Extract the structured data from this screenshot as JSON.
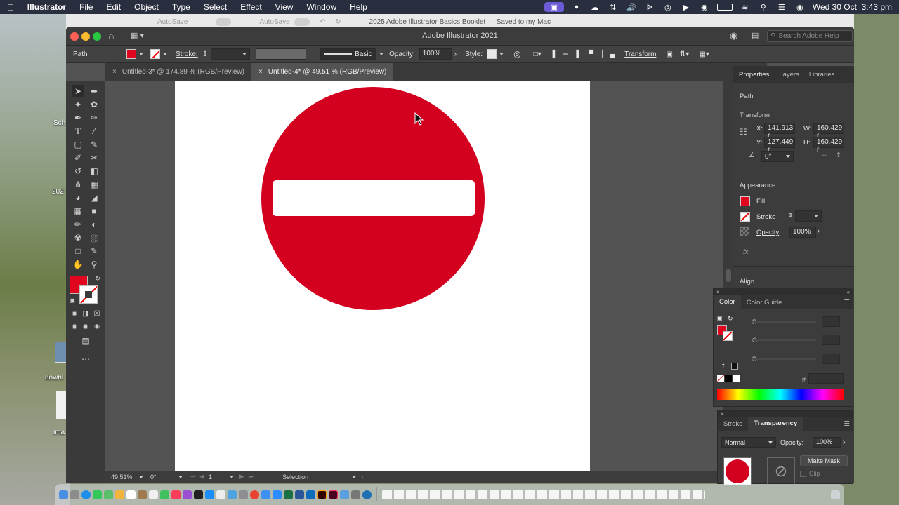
{
  "menubar": {
    "app_name": "Illustrator",
    "items": [
      "File",
      "Edit",
      "Object",
      "Type",
      "Select",
      "Effect",
      "View",
      "Window",
      "Help"
    ],
    "datetime": "Wed 30 Oct  3:43 pm"
  },
  "desktop": {
    "labels": [
      "Sch",
      "202",
      "downl",
      "ima"
    ]
  },
  "autosave": {
    "label1": "AutoSave",
    "label2": "AutoSave",
    "doc_title": "2025 Adobe Illustrator Basics Booklet — Saved to my Mac"
  },
  "window": {
    "title": "Adobe Illustrator 2021",
    "search_placeholder": "Search Adobe Help"
  },
  "control_bar": {
    "selection_type": "Path",
    "fill_color": "#e0061f",
    "stroke_label": "Stroke:",
    "brush_label": "Basic",
    "opacity_label": "Opacity:",
    "opacity_value": "100%",
    "style_label": "Style:",
    "transform_label": "Transform"
  },
  "tabs": [
    {
      "label": "Untitled-3* @ 174.89 % (RGB/Preview)",
      "active": false
    },
    {
      "label": "Untitled-4* @ 49.51 % (RGB/Preview)",
      "active": true
    }
  ],
  "artwork": {
    "sign_color": "#d4001f",
    "bar_color": "#ffffff"
  },
  "status_bar": {
    "zoom": "49.51%",
    "rotation": "0°",
    "artboard_number": "1",
    "tool_name": "Selection"
  },
  "properties_panel": {
    "tabs": [
      "Properties",
      "Layers",
      "Libraries"
    ],
    "selection_type": "Path",
    "transform_heading": "Transform",
    "x_label": "X:",
    "x_value": "141.913 r",
    "y_label": "Y:",
    "y_value": "127.449 r",
    "w_label": "W:",
    "w_value": "160.429 r",
    "h_label": "H:",
    "h_value": "160.429 r",
    "angle_value": "0°",
    "appearance_heading": "Appearance",
    "fill_label": "Fill",
    "stroke_label": "Stroke",
    "opacity_label": "Opacity",
    "opacity_value": "100%",
    "fx_label": "fx.",
    "align_heading": "Align"
  },
  "color_panel": {
    "tabs": [
      "Color",
      "Color Guide"
    ],
    "r_label": "R",
    "g_label": "G",
    "b_label": "B",
    "hex_label": "#"
  },
  "transparency_panel": {
    "tabs": [
      "Stroke",
      "Transparency"
    ],
    "blend_mode": "Normal",
    "opacity_label": "Opacity:",
    "opacity_value": "100%",
    "make_mask_label": "Make Mask",
    "clip_label": "Clip"
  }
}
